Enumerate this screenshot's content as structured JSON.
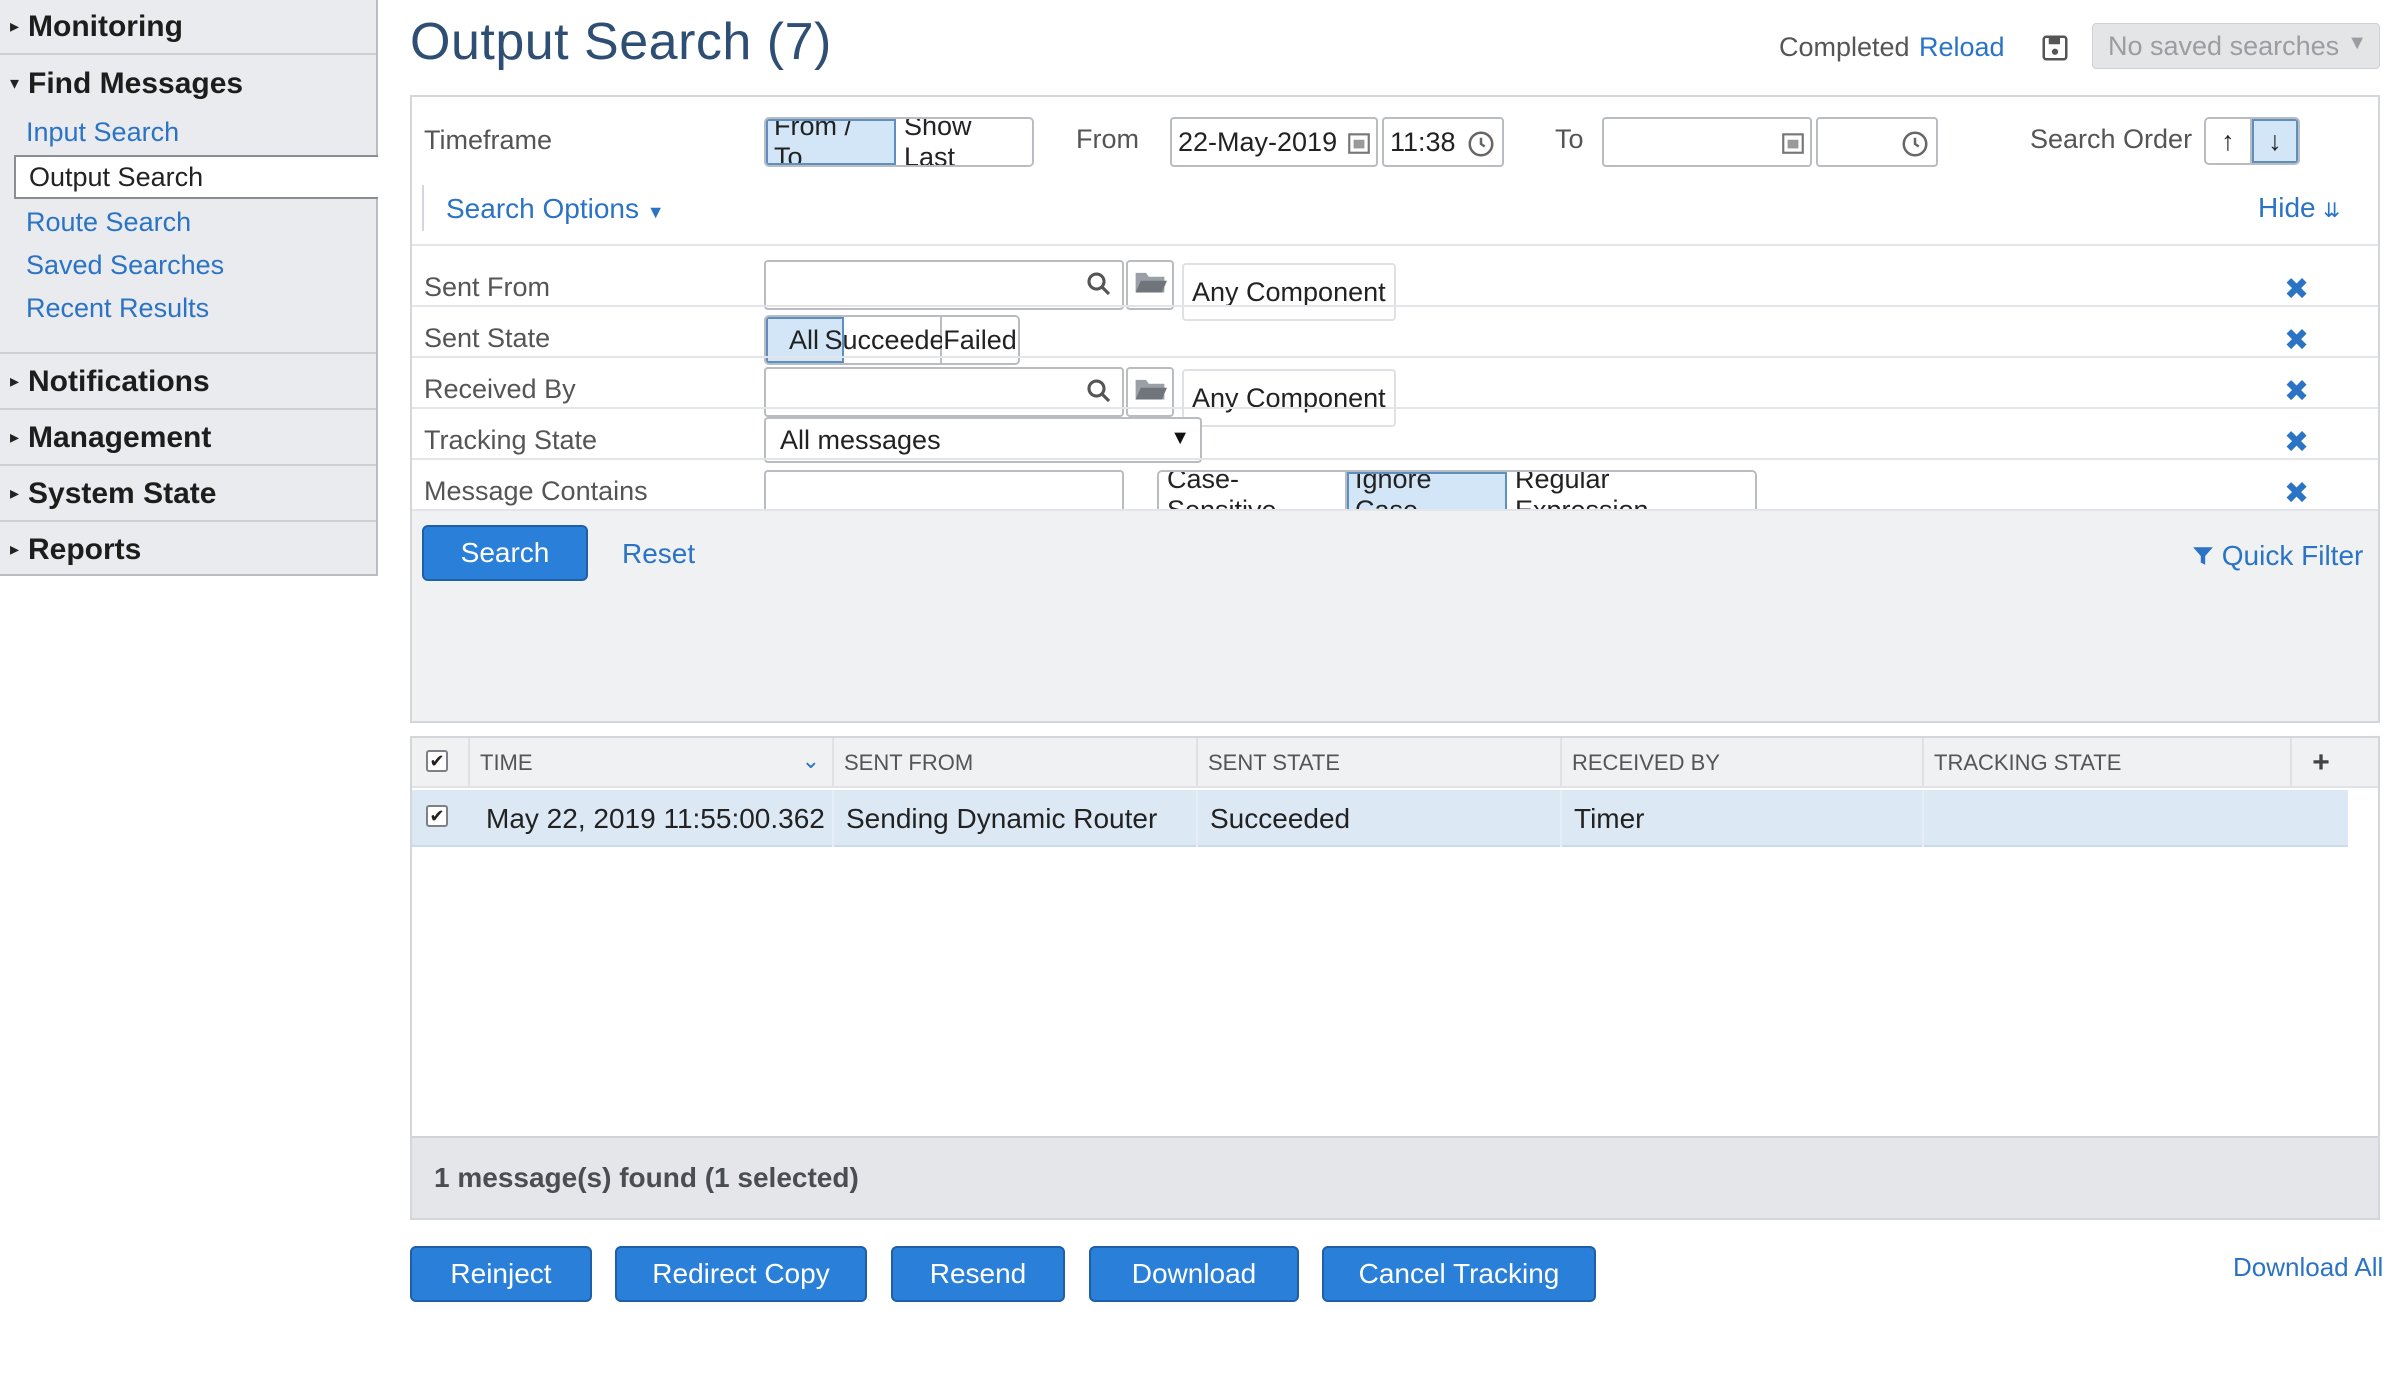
{
  "sidebar": {
    "sections": [
      {
        "label": "Monitoring",
        "expanded": false
      },
      {
        "label": "Find Messages",
        "expanded": true
      },
      {
        "label": "Notifications",
        "expanded": false
      },
      {
        "label": "Management",
        "expanded": false
      },
      {
        "label": "System State",
        "expanded": false
      },
      {
        "label": "Reports",
        "expanded": false
      }
    ],
    "find_items": [
      "Input Search",
      "Output Search",
      "Route Search",
      "Saved Searches",
      "Recent Results"
    ],
    "active_item": "Output Search"
  },
  "header": {
    "title": "Output Search (7)",
    "status": "Completed",
    "reload": "Reload",
    "saved_searches": "No saved searches"
  },
  "timeframe": {
    "label": "Timeframe",
    "modes": [
      "From / To",
      "Show Last"
    ],
    "active_mode": "From / To",
    "from_label": "From",
    "from_date": "22-May-2019",
    "from_time": "11:38",
    "to_label": "To",
    "to_date": "",
    "to_time": "",
    "search_order_label": "Search Order"
  },
  "search_options": {
    "label": "Search Options",
    "hide": "Hide"
  },
  "filters": {
    "sent_from": {
      "label": "Sent From",
      "component": "Any Component",
      "value": ""
    },
    "sent_state": {
      "label": "Sent State",
      "options": [
        "All",
        "Succeeded",
        "Failed"
      ],
      "active": "All"
    },
    "received_by": {
      "label": "Received By",
      "component": "Any Component",
      "value": ""
    },
    "tracking_state": {
      "label": "Tracking State",
      "selected": "All messages"
    },
    "message_contains": {
      "label": "Message Contains",
      "value": "",
      "modes": [
        "Case-Sensitive",
        "Ignore Case",
        "Regular Expression"
      ],
      "active": "Ignore Case"
    }
  },
  "actions_top": {
    "search": "Search",
    "reset": "Reset",
    "quick_filter": "Quick Filter"
  },
  "table": {
    "columns": [
      "TIME",
      "SENT FROM",
      "SENT STATE",
      "RECEIVED BY",
      "TRACKING STATE"
    ],
    "rows": [
      {
        "time": "May 22, 2019 11:55:00.362",
        "sent_from": "Sending Dynamic Router",
        "sent_state": "Succeeded",
        "received_by": "Timer",
        "tracking_state": ""
      }
    ],
    "summary": "1 message(s) found (1 selected)"
  },
  "actions_bottom": {
    "reinject": "Reinject",
    "redirect_copy": "Redirect Copy",
    "resend": "Resend",
    "download": "Download",
    "cancel_tracking": "Cancel Tracking",
    "download_all": "Download All"
  },
  "colors": {
    "accent": "#2a7fd8",
    "link": "#2b73c4",
    "selected_row": "#dce9f5",
    "title": "#2e4f73"
  }
}
